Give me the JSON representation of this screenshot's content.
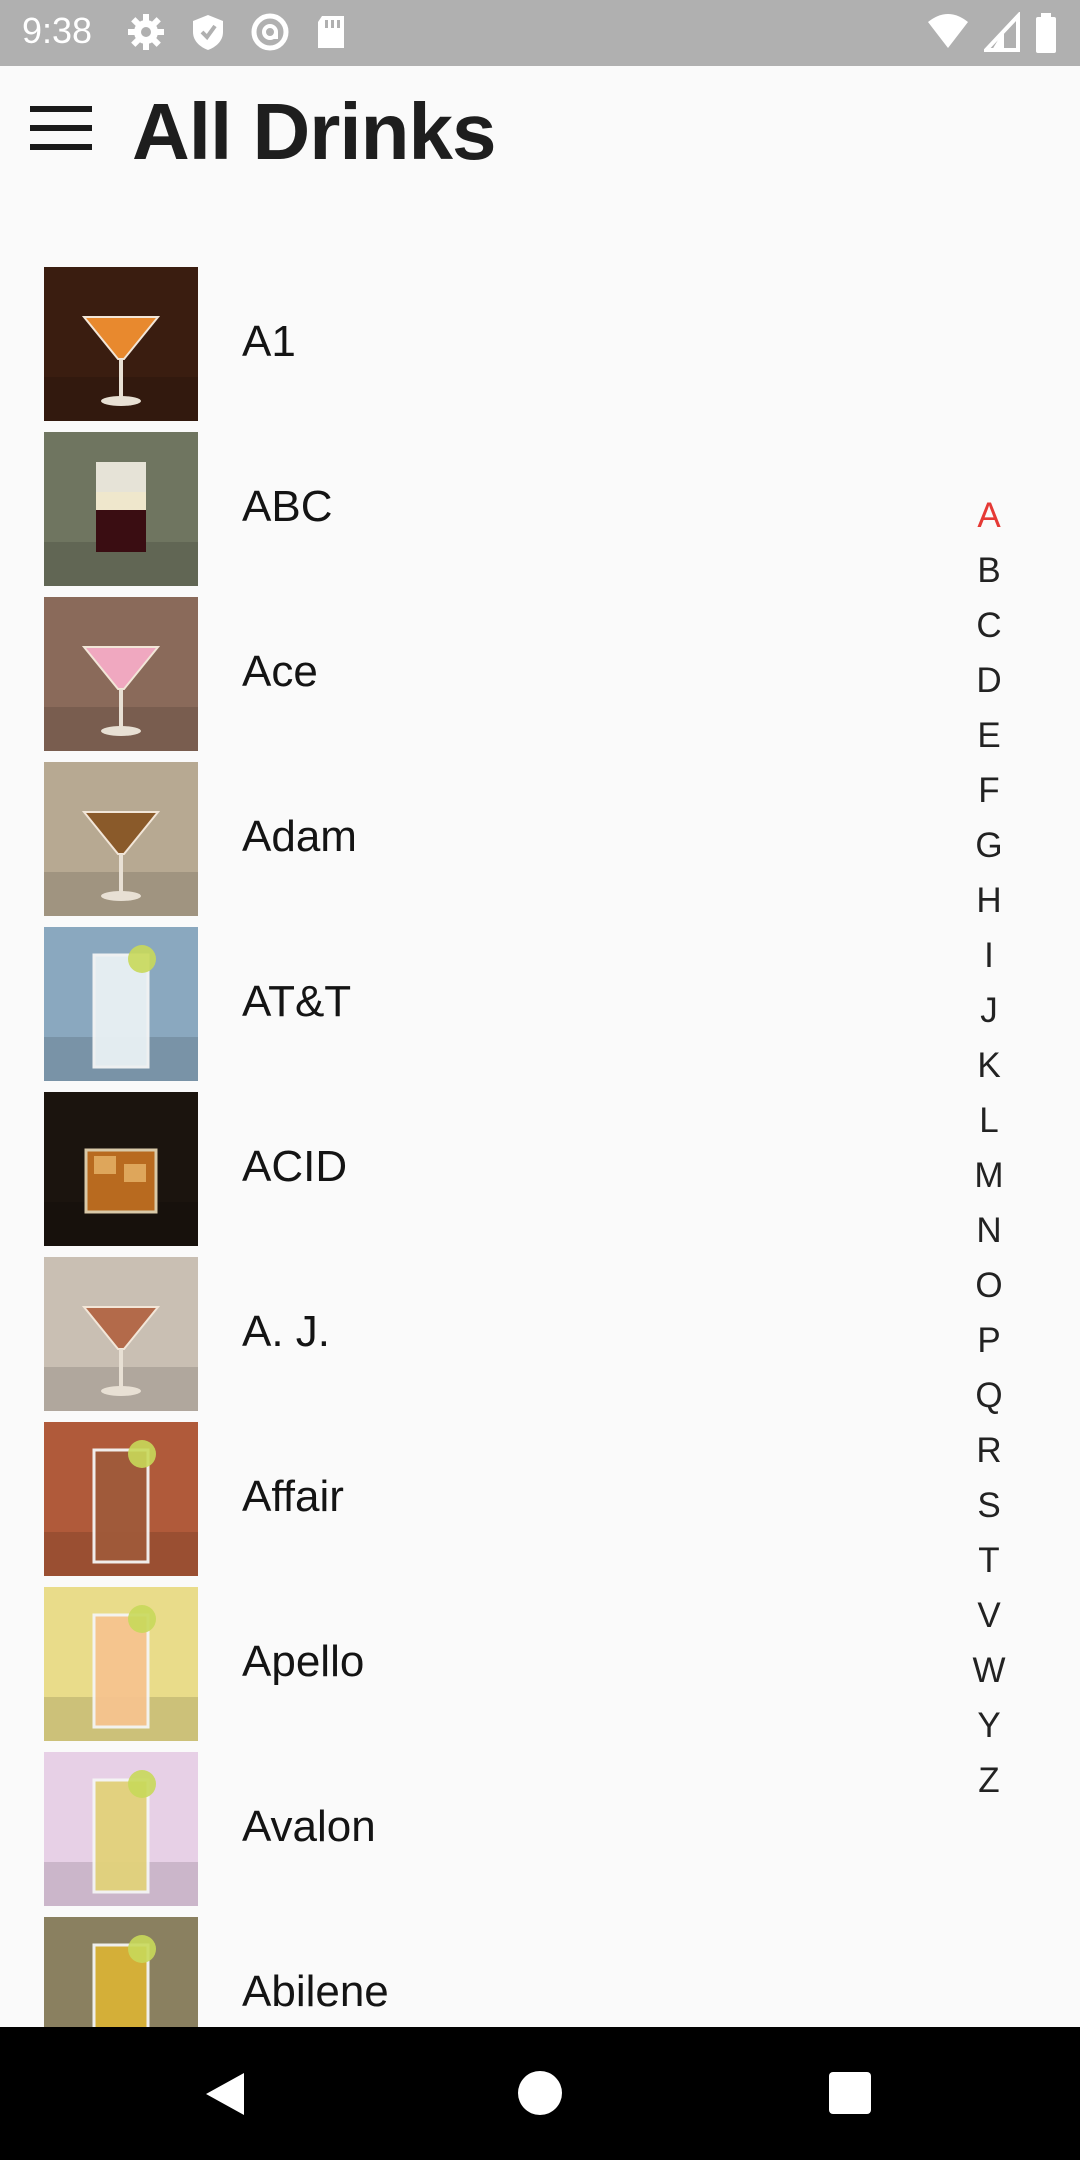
{
  "status_bar": {
    "time": "9:38",
    "left_icons": [
      "gear-icon",
      "shield-icon",
      "at-sign-icon",
      "sd-card-icon"
    ],
    "right_icons": [
      "wifi-icon",
      "signal-icon",
      "battery-icon"
    ]
  },
  "app_bar": {
    "menu_icon": "hamburger-menu-icon",
    "title": "All Drinks"
  },
  "drinks": [
    {
      "name": "A1",
      "thumb": {
        "bg": "#3a1d10",
        "liquid": "#e8892e",
        "glass": "martini"
      }
    },
    {
      "name": "ABC",
      "thumb": {
        "bg": "#6f7560",
        "liquid": "#3a0d12",
        "glass": "shot"
      }
    },
    {
      "name": "Ace",
      "thumb": {
        "bg": "#8a6a5a",
        "liquid": "#f0a8c0",
        "glass": "martini"
      }
    },
    {
      "name": "Adam",
      "thumb": {
        "bg": "#b7a992",
        "liquid": "#8a5a2a",
        "glass": "martini"
      }
    },
    {
      "name": "AT&T",
      "thumb": {
        "bg": "#8aa8bf",
        "liquid": "#e9f1f4",
        "glass": "highball"
      }
    },
    {
      "name": "ACID",
      "thumb": {
        "bg": "#1b140e",
        "liquid": "#b86a1f",
        "glass": "rocks"
      }
    },
    {
      "name": "A. J.",
      "thumb": {
        "bg": "#c9bfb3",
        "liquid": "#b36a4a",
        "glass": "martini"
      }
    },
    {
      "name": "Affair",
      "thumb": {
        "bg": "#b05a3a",
        "liquid": "#a05a3a",
        "glass": "highball"
      }
    },
    {
      "name": "Apello",
      "thumb": {
        "bg": "#e9dc8a",
        "liquid": "#f6c48f",
        "glass": "highball"
      }
    },
    {
      "name": "Avalon",
      "thumb": {
        "bg": "#e7d0e6",
        "liquid": "#e2d27a",
        "glass": "highball"
      }
    },
    {
      "name": "Abilene",
      "thumb": {
        "bg": "#8a8060",
        "liquid": "#d8b236",
        "glass": "highball"
      }
    }
  ],
  "alphabet_index": {
    "letters": [
      "A",
      "B",
      "C",
      "D",
      "E",
      "F",
      "G",
      "H",
      "I",
      "J",
      "K",
      "L",
      "M",
      "N",
      "O",
      "P",
      "Q",
      "R",
      "S",
      "T",
      "V",
      "W",
      "Y",
      "Z"
    ],
    "active": "A",
    "active_color": "#e53935"
  },
  "nav_bar": {
    "icons": [
      "back-icon",
      "home-icon",
      "recents-icon"
    ]
  }
}
